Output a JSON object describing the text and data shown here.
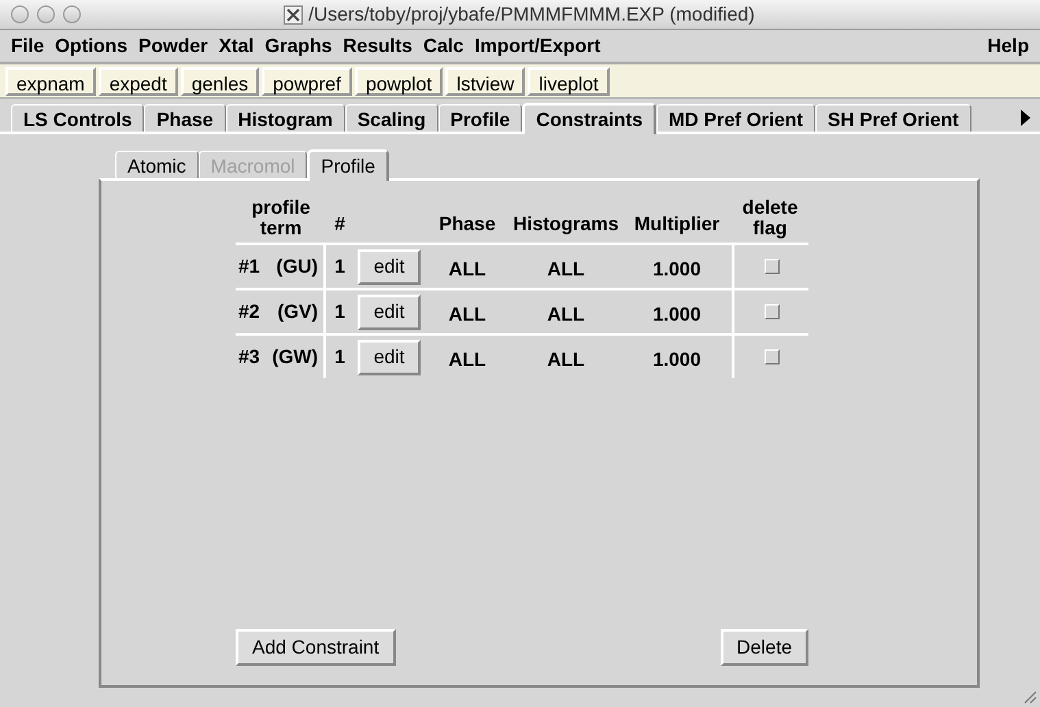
{
  "window": {
    "title": "/Users/toby/proj/ybafe/PMMMFMMM.EXP (modified)"
  },
  "menu": [
    "File",
    "Options",
    "Powder",
    "Xtal",
    "Graphs",
    "Results",
    "Calc",
    "Import/Export"
  ],
  "help_menu": "Help",
  "toolbar": [
    "expnam",
    "expedt",
    "genles",
    "powpref",
    "powplot",
    "lstview",
    "liveplot"
  ],
  "tabs": [
    {
      "label": "LS Controls",
      "selected": false
    },
    {
      "label": "Phase",
      "selected": false
    },
    {
      "label": "Histogram",
      "selected": false
    },
    {
      "label": "Scaling",
      "selected": false
    },
    {
      "label": "Profile",
      "selected": false
    },
    {
      "label": "Constraints",
      "selected": true
    },
    {
      "label": "MD Pref Orient",
      "selected": false
    },
    {
      "label": "SH Pref Orient",
      "selected": false
    }
  ],
  "subtabs": [
    {
      "label": "Atomic",
      "selected": false,
      "disabled": false
    },
    {
      "label": "Macromol",
      "selected": false,
      "disabled": true
    },
    {
      "label": "Profile",
      "selected": true,
      "disabled": false
    }
  ],
  "table": {
    "columns": [
      "profile term",
      "#",
      "Phase",
      "Histograms",
      "Multiplier",
      "delete flag"
    ],
    "rows": [
      {
        "term": "#1",
        "code": "(GU)",
        "number": "1",
        "button": "edit",
        "phase": "ALL",
        "histograms": "ALL",
        "multiplier": "1.000",
        "delete": false
      },
      {
        "term": "#2",
        "code": "(GV)",
        "number": "1",
        "button": "edit",
        "phase": "ALL",
        "histograms": "ALL",
        "multiplier": "1.000",
        "delete": false
      },
      {
        "term": "#3",
        "code": "(GW)",
        "number": "1",
        "button": "edit",
        "phase": "ALL",
        "histograms": "ALL",
        "multiplier": "1.000",
        "delete": false
      }
    ]
  },
  "buttons": {
    "add": "Add Constraint",
    "delete": "Delete"
  }
}
